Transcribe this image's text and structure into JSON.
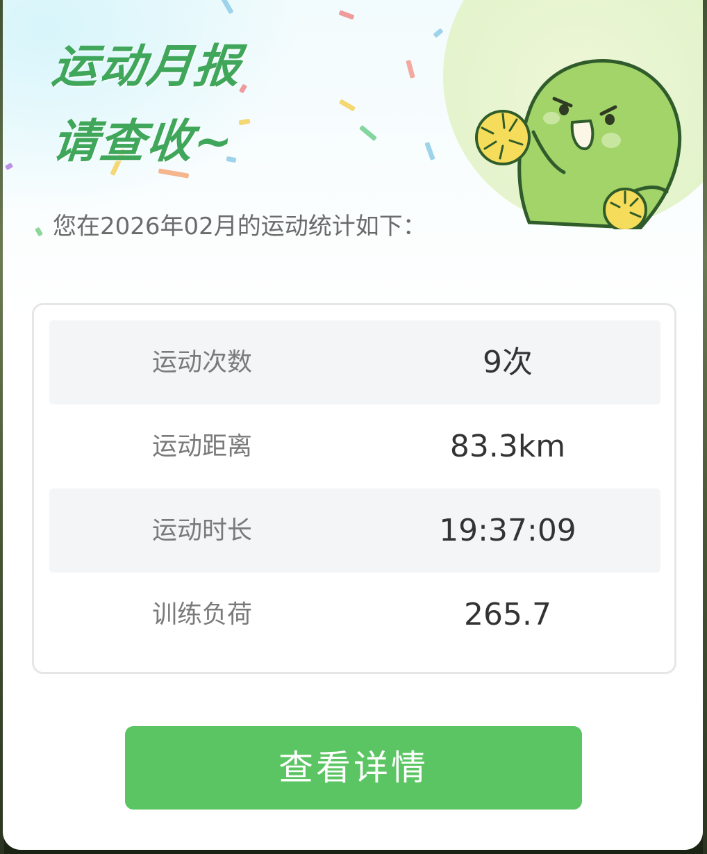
{
  "report": {
    "title_line1": "运动月报",
    "title_line2": "请查收~",
    "subtitle": "您在2026年02月的运动统计如下："
  },
  "stats": [
    {
      "label": "运动次数",
      "value": "9次"
    },
    {
      "label": "运动距离",
      "value": "83.3km"
    },
    {
      "label": "运动时长",
      "value": "19:37:09"
    },
    {
      "label": "训练负荷",
      "value": "265.7"
    }
  ],
  "actions": {
    "detail_button_label": "查看详情"
  },
  "colors": {
    "accent_green": "#3fa65a",
    "button_green": "#5bc563",
    "row_shade": "#f4f5f7",
    "mascot_green": "#a3d46a"
  },
  "icons": {
    "mascot": "cheering-green-mascot-illustration",
    "decor": "confetti-decoration"
  }
}
